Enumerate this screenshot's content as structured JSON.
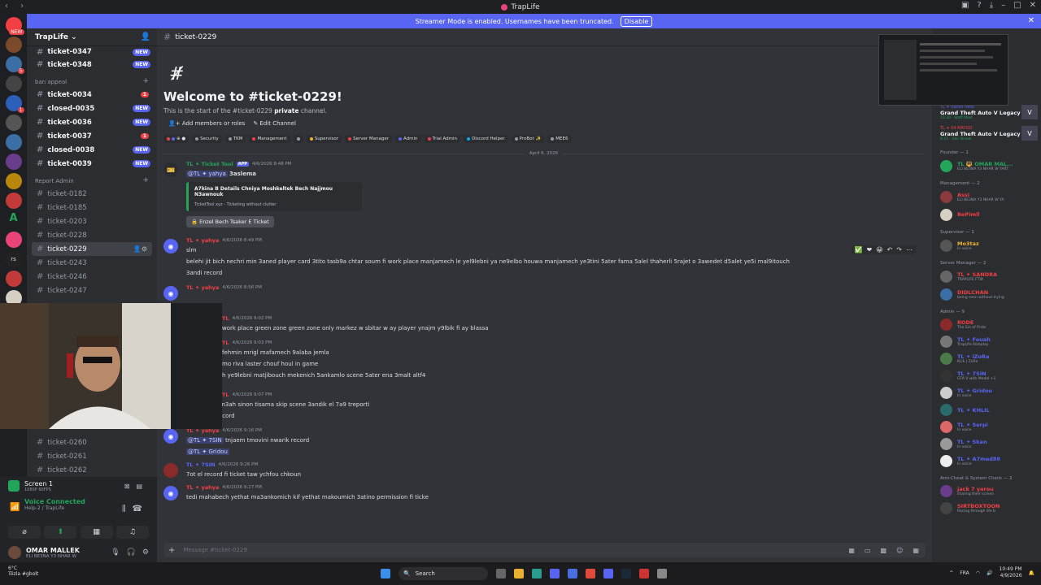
{
  "window": {
    "title": "TrapLife"
  },
  "banner": {
    "text": "Streamer Mode is enabled. Usernames have been truncated.",
    "button": "Disable"
  },
  "server": {
    "name": "TrapLife"
  },
  "channels": {
    "top": [
      {
        "name": "ticket-0347",
        "badge": "NEW"
      },
      {
        "name": "ticket-0348",
        "badge": "NEW"
      }
    ],
    "cat1": "ban appeal",
    "cat1_items": [
      {
        "name": "ticket-0034",
        "red": "1"
      },
      {
        "name": "closed-0035",
        "badge": "NEW"
      },
      {
        "name": "ticket-0036",
        "badge": "NEW"
      },
      {
        "name": "ticket-0037",
        "red": "1"
      },
      {
        "name": "closed-0038",
        "badge": "NEW"
      },
      {
        "name": "ticket-0039",
        "badge": "NEW"
      }
    ],
    "cat2": "Report Admin",
    "cat2_items": [
      "ticket-0182",
      "ticket-0185",
      "ticket-0203",
      "ticket-0228",
      "ticket-0229",
      "ticket-0243",
      "ticket-0246",
      "ticket-0247"
    ],
    "lower_items": [
      "ticket-0260",
      "ticket-0261",
      "ticket-0262"
    ]
  },
  "userpanel": {
    "screen": "Screen 1",
    "screen_sub": "1080P 60FPS",
    "voice": "Voice Connected",
    "voice_sub": "Help-2 / TrapLife",
    "user": "OMAR MALLEK",
    "user_sub": "ELI BE3NA Y3 NHAR W"
  },
  "channel": {
    "name": "ticket-0229",
    "welcome": "Welcome to #ticket-0229!",
    "desc_pre": "This is the start of the #ticket-0229",
    "desc_bold": "private",
    "desc_post": "channel.",
    "add_members": "Add members or roles",
    "edit_channel": "Edit Channel",
    "roles": [
      {
        "label": "Security",
        "color": "#949ba4"
      },
      {
        "label": "TKM",
        "color": "#949ba4"
      },
      {
        "label": "Management",
        "color": "#f23f43"
      },
      {
        "label": "Supervisor",
        "color": "#f0b232"
      },
      {
        "label": "Server Manager",
        "color": "#f23f43"
      },
      {
        "label": "Admin",
        "color": "#5865f2"
      },
      {
        "label": "Trial Admin",
        "color": "#f23f43"
      },
      {
        "label": "Discord Helper",
        "color": "#00a8fc"
      },
      {
        "label": "ProBot ✨",
        "color": "#949ba4"
      },
      {
        "label": "MEE6",
        "color": "#949ba4"
      }
    ],
    "date_divider": "April 6, 2026"
  },
  "messages": [
    {
      "author": "TL ✦ Ticket Tool",
      "app": "APP",
      "time": "4/6/2026 8:48 PM",
      "mention": "@TL ✦ yahya",
      "text": "3aslema",
      "embed_title": "A7kina B Details Chniya Moshkeltek Bech Najjmou N3awnouk",
      "embed_footer": "TicketTool.xyz - Ticketing without clutter",
      "button": "🔒 Enzel Bech Tsaker E Ticket"
    },
    {
      "author": "TL ✦ yahya",
      "time": "4/6/2026 8:49 PM",
      "text": "slm",
      "text2": "belehi jit bich nechri min 3aned player card 3tito tasb9a chtar soum fi work place manjamech le yel9lebni ya ne9elbo houwa manjamech ye3tini 5ater fama 5alel thaherli 5rajet o 3awedet d5alet ye5i mal9itouch",
      "text3": "3andi record",
      "side_time": "8:53 PM"
    },
    {
      "author": "TL ✦ yahya",
      "time": "4/6/2026 8:56 PM"
    },
    {
      "author": "TL",
      "time": "4/6/2026 9:02 PM",
      "text": "work place green zone green zone only markez w sbitar w ay player ynajm y9lbik fi ay blassa"
    },
    {
      "author": "TL",
      "time": "4/6/2026 9:03 PM",
      "text": "fehmin mrigl mafamech 9alaba jemla",
      "text2": "mo riva laster chouf houl in game",
      "text3": "h ye9lebni matjibouch mekenich 5ankamlo scene 5ater ena 3malt altf4"
    },
    {
      "author": "TL",
      "time": "4/6/2026 9:07 PM",
      "text": "taw nchouf m3ah sinon tisama skip scene 3andik el 7a9 treporti",
      "text2": "just 7ot el record"
    },
    {
      "author": "TL ✦ yahya",
      "time": "4/6/2026 9:16 PM",
      "mention": "@TL ✦ 7SIN",
      "text": "tnjaem tmovini nwarik record",
      "mention2": "@TL ✦ Gridou"
    },
    {
      "author": "TL ✦ 7SIN",
      "time": "4/6/2026 9:26 PM",
      "text": "7ot el record fi ticket taw ychfou chkoun"
    },
    {
      "author": "TL ✦ yahya",
      "time": "4/6/2026 9:27 PM",
      "text": "tedi mahabech yethat ma3ankomich kif yethat makoumich 3atino permission fi ticke"
    }
  ],
  "composer": {
    "placeholder": "Message #ticket-0229"
  },
  "members": {
    "activities": [
      {
        "name": "TL ✦ hadilo hefzi",
        "title": "Grand Theft Auto V Legacy",
        "sub": "15:30 · Staff Mast"
      },
      {
        "name": "TL ✦ 04 MATOO",
        "title": "Grand Theft Auto V Legacy",
        "sub": "6:15 · 18x Streak"
      }
    ],
    "groups": [
      {
        "title": "Founder — 1",
        "items": [
          {
            "name": "TL 🔱 OMAR MAL...",
            "sub": "ELI BE3NA Y3 NHAR W YART",
            "color": "#23a55a"
          }
        ]
      },
      {
        "title": "Management — 2",
        "items": [
          {
            "name": "Assi",
            "sub": "ELI BE3NA Y3 NHAR W YA",
            "color": "#f23f43"
          },
          {
            "name": "BePimll",
            "sub": "",
            "color": "#f23f43"
          }
        ]
      },
      {
        "title": "Supervisor — 1",
        "items": [
          {
            "name": "Mo3taz",
            "sub": "In voice",
            "color": "#f0b232"
          }
        ]
      },
      {
        "title": "Server Manager — 2",
        "items": [
          {
            "name": "TL ✦ SANDRA",
            "sub": "TRAPLIFE FTW",
            "color": "#f23f43"
          },
          {
            "name": "DIDLCHAN",
            "sub": "being seen without trying",
            "color": "#f23f43"
          }
        ]
      },
      {
        "title": "Admin — 9",
        "items": [
          {
            "name": "RODE",
            "sub": "The Sin of Pride",
            "color": "#f23f43"
          },
          {
            "name": "TL ✦ Fouah",
            "sub": "TrapLife Roleplay",
            "color": "#5865f2"
          },
          {
            "name": "TL ✦ iZoRa",
            "sub": "Kick | ZoRa",
            "color": "#5865f2"
          },
          {
            "name": "TL ✦ 7SIN",
            "sub": "GTA V with Medal +1",
            "color": "#5865f2"
          },
          {
            "name": "TL ✦ Gridou",
            "sub": "In voice",
            "color": "#5865f2"
          },
          {
            "name": "TL ✦ KHLIL",
            "sub": "",
            "color": "#5865f2"
          },
          {
            "name": "TL ✦ Serpi",
            "sub": "In voice",
            "color": "#5865f2"
          },
          {
            "name": "TL ✦ Skan",
            "sub": "In voice",
            "color": "#5865f2"
          },
          {
            "name": "TL ✦ A7med88",
            "sub": "In voice",
            "color": "#5865f2"
          }
        ]
      },
      {
        "title": "Anti-Cheat & System Check — 2",
        "items": [
          {
            "name": "jack 7 yerou",
            "sub": "sharing their screen",
            "color": "#f23f43"
          },
          {
            "name": "SIRTBOXTOON",
            "sub": "Racing through life b",
            "color": "#f23f43"
          }
        ]
      }
    ]
  },
  "taskbar": {
    "temp": "6°C",
    "weather": "Tözla #gbolt",
    "search": "Search",
    "lang": "FRA",
    "time": "10:49 PM",
    "date": "4/9/2026"
  }
}
